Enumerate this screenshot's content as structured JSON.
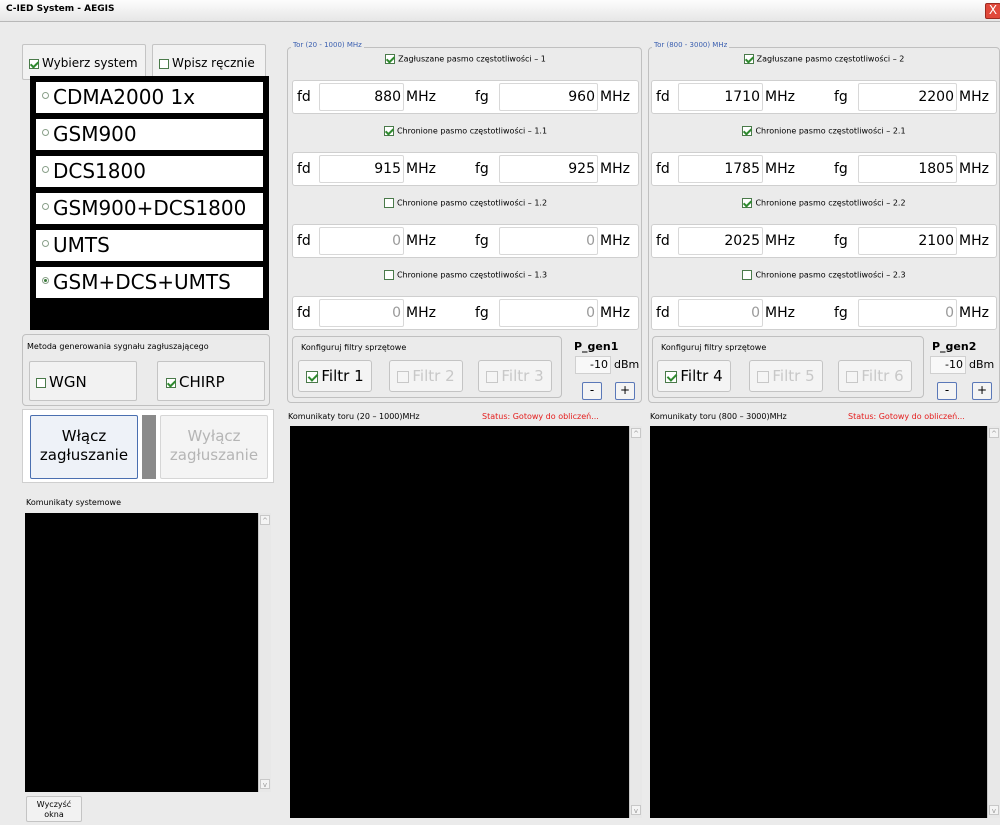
{
  "window": {
    "title": "C-IED System - AEGIS",
    "close_glyph": "X"
  },
  "system": {
    "select_label": "Wybierz system",
    "manual_label": "Wpisz ręcznie",
    "items": [
      "CDMA2000 1x",
      "GSM900",
      "DCS1800",
      "GSM900+DCS1800",
      "UMTS",
      "GSM+DCS+UMTS"
    ],
    "selected_index": 5
  },
  "method": {
    "title": "Metoda generowania sygnału zagłuszającego",
    "wgn": "WGN",
    "chirp": "CHIRP"
  },
  "jam": {
    "on_line1": "Włącz",
    "on_line2": "zagłuszanie",
    "off_line1": "Wyłącz",
    "off_line2": "zagłuszanie"
  },
  "sysmsg": {
    "title": "Komunikaty systemowe",
    "clear_line1": "Wyczyść",
    "clear_line2": "okna"
  },
  "track1": {
    "legend": "Tor (20 - 1000) MHz",
    "bands": [
      {
        "title": "Zagłuszane pasmo częstotliwości – 1",
        "checked": true,
        "fd": "880",
        "fg": "960"
      },
      {
        "title": "Chronione pasmo częstotliwości – 1.1",
        "checked": true,
        "fd": "915",
        "fg": "925"
      },
      {
        "title": "Chronione pasmo częstotliwości – 1.2",
        "checked": false,
        "fd": "0",
        "fg": "0"
      },
      {
        "title": "Chronione pasmo częstotliwości – 1.3",
        "checked": false,
        "fd": "0",
        "fg": "0"
      }
    ],
    "filters_title": "Konfiguruj filtry sprzętowe",
    "filters": [
      "Filtr 1",
      "Filtr 2",
      "Filtr 3"
    ],
    "pgen_label": "P_gen1",
    "pgen_value": "-10",
    "pgen_unit": "dBm",
    "messages_label": "Komunikaty toru (20 – 1000)MHz",
    "status": "Status: Gotowy do obliczeń..."
  },
  "track2": {
    "legend": "Tor (800 - 3000) MHz",
    "bands": [
      {
        "title": "Zagłuszane pasmo częstotliwości – 2",
        "checked": true,
        "fd": "1710",
        "fg": "2200"
      },
      {
        "title": "Chronione pasmo częstotliwości – 2.1",
        "checked": true,
        "fd": "1785",
        "fg": "1805"
      },
      {
        "title": "Chronione pasmo częstotliwości – 2.2",
        "checked": true,
        "fd": "2025",
        "fg": "2100"
      },
      {
        "title": "Chronione pasmo częstotliwości – 2.3",
        "checked": false,
        "fd": "0",
        "fg": "0"
      }
    ],
    "filters_title": "Konfiguruj filtry sprzętowe",
    "filters": [
      "Filtr 4",
      "Filtr 5",
      "Filtr 6"
    ],
    "pgen_label": "P_gen2",
    "pgen_value": "-10",
    "pgen_unit": "dBm",
    "messages_label": "Komunikaty toru (800 – 3000)MHz",
    "status": "Status: Gotowy do obliczeń..."
  },
  "labels": {
    "fd": "fd",
    "fg": "fg",
    "mhz": "MHz",
    "minus": "-",
    "plus": "+"
  }
}
